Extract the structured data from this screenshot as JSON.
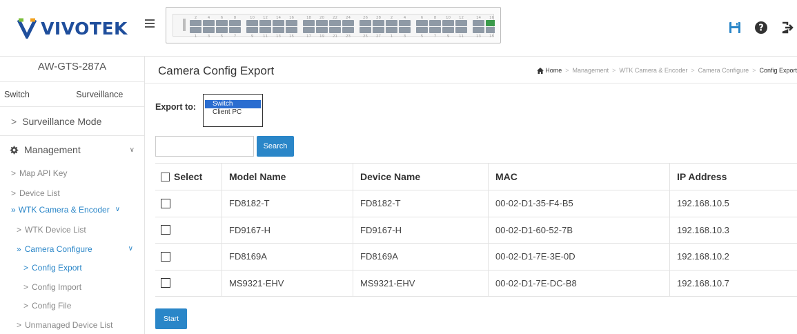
{
  "brand": {
    "logo_text": "VIVOTEK",
    "color": "#1f4e9c"
  },
  "header": {
    "icons": [
      "save-icon",
      "help-icon",
      "logout-icon"
    ],
    "port_panel": {
      "top_numbers": [
        "2",
        "4",
        "6",
        "8",
        "10",
        "12",
        "14",
        "16",
        "18",
        "20",
        "22",
        "24",
        "26",
        "28"
      ],
      "bottom_numbers": [
        "1",
        "3",
        "5",
        "7",
        "9",
        "11",
        "13",
        "15",
        "17",
        "19",
        "21",
        "23",
        "25",
        "27"
      ],
      "bottom_extra": [
        "25",
        "26",
        "27",
        "28"
      ]
    }
  },
  "sidebar": {
    "model": "AW-GTS-287A",
    "tabs": {
      "switch": "Switch",
      "surveillance": "Surveillance"
    },
    "surveillance_mode": "Surveillance Mode",
    "management": "Management",
    "items": {
      "map_api_key": "Map API Key",
      "device_list": "Device List",
      "vivotek_camera": "WTK Camera & Encoder",
      "vivotek_device_list": "WTK Device List",
      "camera_configure": "Camera Configure",
      "config_export": "Config Export",
      "config_import": "Config Import",
      "config_file": "Config File",
      "unmanaged_device_list": "Unmanaged Device List"
    }
  },
  "page": {
    "title": "Camera Config Export",
    "breadcrumb": {
      "home": "Home",
      "items": [
        "Management",
        "WTK Camera & Encoder",
        "Camera Configure"
      ],
      "current": "Config Export"
    }
  },
  "export": {
    "label": "Export to:",
    "options": [
      "Switch",
      "Client PC"
    ],
    "selected": "Switch"
  },
  "search": {
    "value": "",
    "button": "Search"
  },
  "table": {
    "headers": {
      "select": "Select",
      "model": "Model Name",
      "device": "Device Name",
      "mac": "MAC",
      "ip": "IP Address"
    },
    "rows": [
      {
        "model": "FD8182-T",
        "device": "FD8182-T",
        "mac": "00-02-D1-35-F4-B5",
        "ip": "192.168.10.5"
      },
      {
        "model": "FD9167-H",
        "device": "FD9167-H",
        "mac": "00-02-D1-60-52-7B",
        "ip": "192.168.10.3"
      },
      {
        "model": "FD8169A",
        "device": "FD8169A",
        "mac": "00-02-D1-7E-3E-0D",
        "ip": "192.168.10.2"
      },
      {
        "model": "MS9321-EHV",
        "device": "MS9321-EHV",
        "mac": "00-02-D1-7E-DC-B8",
        "ip": "192.168.10.7"
      }
    ]
  },
  "actions": {
    "start": "Start"
  },
  "colors": {
    "accent": "#2a86c8",
    "select_highlight": "#2a6dd0",
    "port_green": "#3a9a4a",
    "port_orange": "#e08a3c"
  }
}
